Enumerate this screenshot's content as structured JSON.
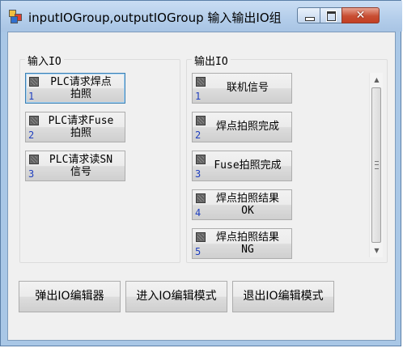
{
  "window": {
    "title": "inputIOGroup,outputIOGroup 输入输出IO组",
    "close_glyph": "✕"
  },
  "input_group": {
    "label": "输入IO",
    "items": [
      {
        "label": "PLC请求焊点\n拍照",
        "index": "1"
      },
      {
        "label": "PLC请求Fuse\n拍照",
        "index": "2"
      },
      {
        "label": "PLC请求读SN\n信号",
        "index": "3"
      }
    ]
  },
  "output_group": {
    "label": "输出IO",
    "items": [
      {
        "label": "联机信号",
        "index": "1"
      },
      {
        "label": "焊点拍照完成",
        "index": "2"
      },
      {
        "label": "Fuse拍照完成",
        "index": "3"
      },
      {
        "label": "焊点拍照结果\nOK",
        "index": "4"
      },
      {
        "label": "焊点拍照结果\nNG",
        "index": "5"
      }
    ]
  },
  "scrollbar": {
    "up_arrow": "▲",
    "down_arrow": "▼"
  },
  "buttons": {
    "popup_editor": "弹出IO编辑器",
    "enter_edit": "进入IO编辑模式",
    "exit_edit": "退出IO编辑模式"
  }
}
